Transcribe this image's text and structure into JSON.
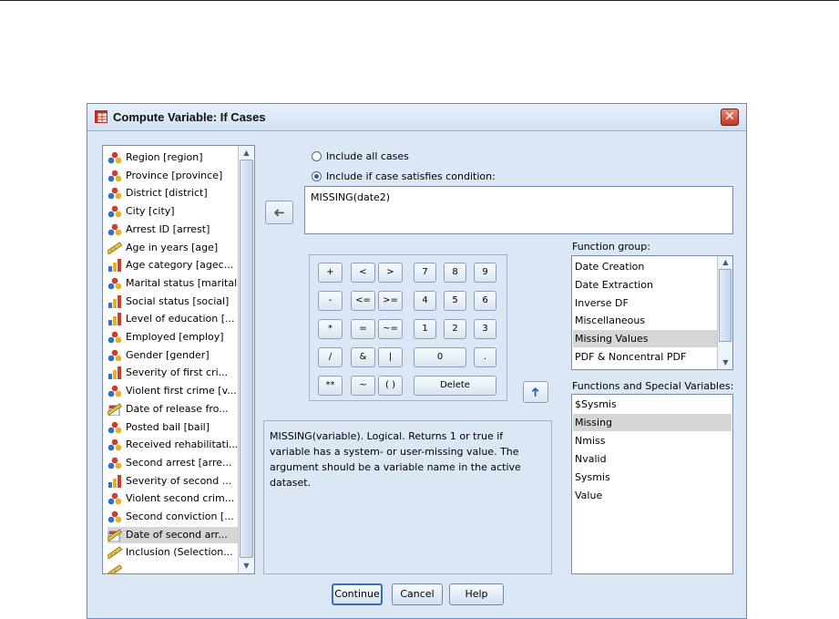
{
  "window": {
    "title": "Compute Variable: If Cases",
    "close_symbol": "✕"
  },
  "variables": [
    {
      "label": "Region [region]",
      "icon": "nominal-icon"
    },
    {
      "label": "Province [province]",
      "icon": "nominal-icon"
    },
    {
      "label": "District [district]",
      "icon": "nominal-icon"
    },
    {
      "label": "City [city]",
      "icon": "nominal-icon"
    },
    {
      "label": "Arrest ID [arrest]",
      "icon": "nominal-icon"
    },
    {
      "label": "Age in years [age]",
      "icon": "scale-icon"
    },
    {
      "label": "Age category [agec...",
      "icon": "ordinal-icon"
    },
    {
      "label": "Marital status [marital]",
      "icon": "nominal-icon"
    },
    {
      "label": "Social status [social]",
      "icon": "ordinal-icon"
    },
    {
      "label": "Level of education [...",
      "icon": "ordinal-icon"
    },
    {
      "label": "Employed [employ]",
      "icon": "nominal-icon"
    },
    {
      "label": "Gender [gender]",
      "icon": "nominal-icon"
    },
    {
      "label": "Severity of first cri...",
      "icon": "ordinal-icon"
    },
    {
      "label": "Violent first crime [v...",
      "icon": "nominal-icon"
    },
    {
      "label": "Date of release fro...",
      "icon": "date-icon"
    },
    {
      "label": "Posted bail [bail]",
      "icon": "nominal-icon"
    },
    {
      "label": "Received rehabilitati...",
      "icon": "nominal-icon"
    },
    {
      "label": "Second arrest [arre...",
      "icon": "nominal-icon"
    },
    {
      "label": "Severity of second ...",
      "icon": "ordinal-icon"
    },
    {
      "label": "Violent second crim...",
      "icon": "nominal-icon"
    },
    {
      "label": "Second conviction [...",
      "icon": "nominal-icon"
    },
    {
      "label": "Date of second arr...",
      "icon": "date-icon",
      "selected": true
    },
    {
      "label": "Inclusion (Selection...",
      "icon": "scale-icon"
    },
    {
      "label": "",
      "icon": "scale-icon"
    }
  ],
  "options": {
    "include_all": "Include all cases",
    "include_if": "Include if case satisfies condition:",
    "selected": "include_if"
  },
  "condition_text": "MISSING(date2)",
  "move_arrow": "➜",
  "up_arrow": "➜",
  "keypad": {
    "row1": [
      "+",
      "<",
      ">",
      "7",
      "8",
      "9"
    ],
    "row2": [
      "-",
      "<=",
      ">=",
      "4",
      "5",
      "6"
    ],
    "row3": [
      "*",
      "=",
      "~=",
      "1",
      "2",
      "3"
    ],
    "row4": [
      "/",
      "&",
      "|",
      "0",
      "."
    ],
    "row5": [
      "**",
      "~",
      "( )",
      "Delete"
    ]
  },
  "description": "MISSING(variable). Logical. Returns 1 or true if variable has a system- or user-missing value. The argument should be a variable name in the active dataset.",
  "function_group": {
    "label": "Function group:",
    "items": [
      "Date Creation",
      "Date Extraction",
      "Inverse DF",
      "Miscellaneous",
      "Missing Values",
      "PDF & Noncentral PDF"
    ],
    "selected": "Missing Values"
  },
  "functions": {
    "label": "Functions and Special Variables:",
    "items": [
      "$Sysmis",
      "Missing",
      "Nmiss",
      "Nvalid",
      "Sysmis",
      "Value"
    ],
    "selected": "Missing"
  },
  "buttons": {
    "continue": "Continue",
    "cancel": "Cancel",
    "help": "Help"
  },
  "colors": {
    "dialog_bg": "#dbe7f4",
    "selection": "#d5d5d5",
    "accent": "#2a5db5"
  }
}
